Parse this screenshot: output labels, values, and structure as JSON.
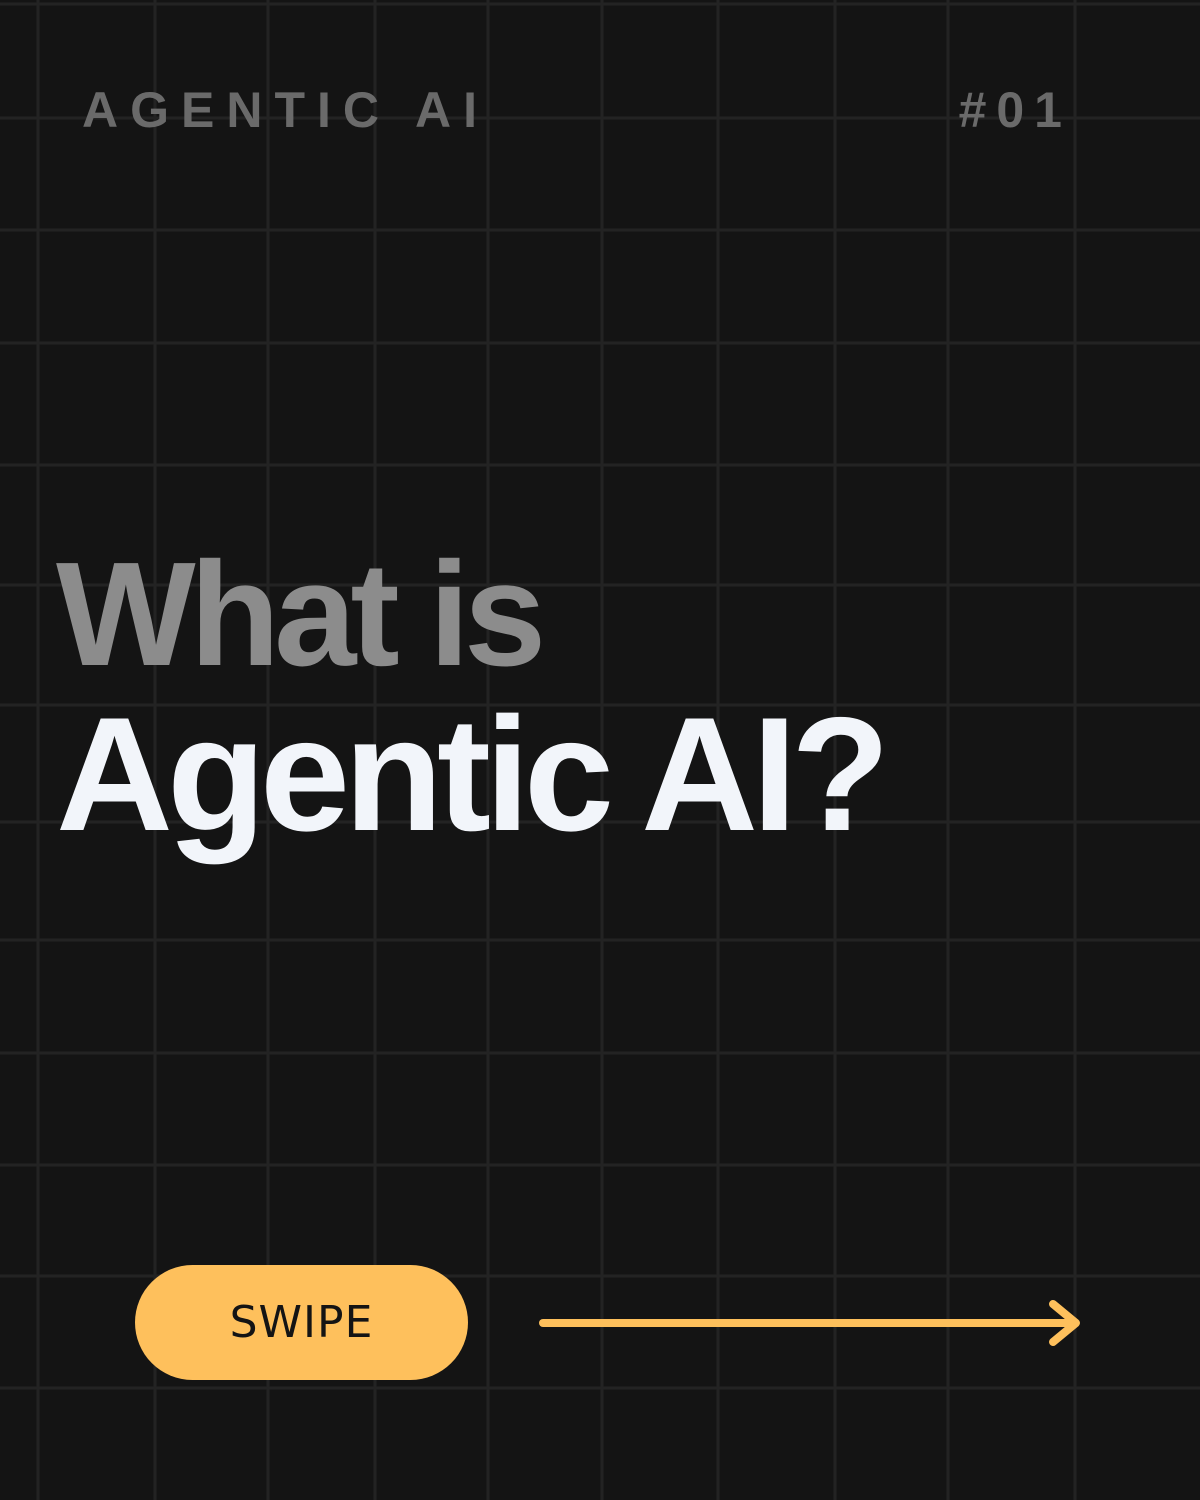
{
  "header": {
    "series_label": "AGENTIC AI",
    "issue_number": "#01"
  },
  "headline": {
    "line1": "What is",
    "line2": "Agentic AI?"
  },
  "cta": {
    "label": "SWIPE",
    "arrow_icon": "arrow-right-icon"
  },
  "colors": {
    "background": "#141414",
    "grid": "#232323",
    "muted_text": "#6a6a6a",
    "headline_muted": "#8c8c8c",
    "headline_primary": "#f2f5fa",
    "accent": "#fec05c"
  }
}
